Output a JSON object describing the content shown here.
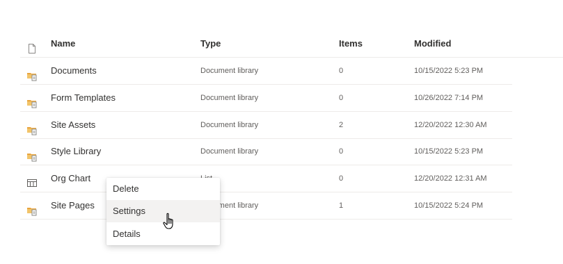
{
  "columns": {
    "type_icon": "document-icon",
    "name": "Name",
    "type": "Type",
    "items": "Items",
    "modified": "Modified"
  },
  "rows": [
    {
      "icon": "library-icon",
      "name": "Documents",
      "type": "Document library",
      "items": "0",
      "modified": "10/15/2022 5:23 PM"
    },
    {
      "icon": "library-icon",
      "name": "Form Templates",
      "type": "Document library",
      "items": "0",
      "modified": "10/26/2022 7:14 PM"
    },
    {
      "icon": "library-icon",
      "name": "Site Assets",
      "type": "Document library",
      "items": "2",
      "modified": "12/20/2022 12:30 AM"
    },
    {
      "icon": "library-icon",
      "name": "Style Library",
      "type": "Document library",
      "items": "0",
      "modified": "10/15/2022 5:23 PM"
    },
    {
      "icon": "list-icon",
      "name": "Org Chart",
      "type": "List",
      "items": "0",
      "modified": "12/20/2022 12:31 AM"
    },
    {
      "icon": "library-icon",
      "name": "Site Pages",
      "type": "Document library",
      "items": "1",
      "modified": "10/15/2022 5:24 PM"
    }
  ],
  "context_menu": {
    "items": [
      {
        "label": "Delete"
      },
      {
        "label": "Settings"
      },
      {
        "label": "Details"
      }
    ],
    "hovered": "Settings"
  },
  "colors": {
    "library_icon": "#e8a33c",
    "border": "#edebe9",
    "secondary_text": "#605e5c",
    "hover_bg": "#f3f2f1"
  }
}
